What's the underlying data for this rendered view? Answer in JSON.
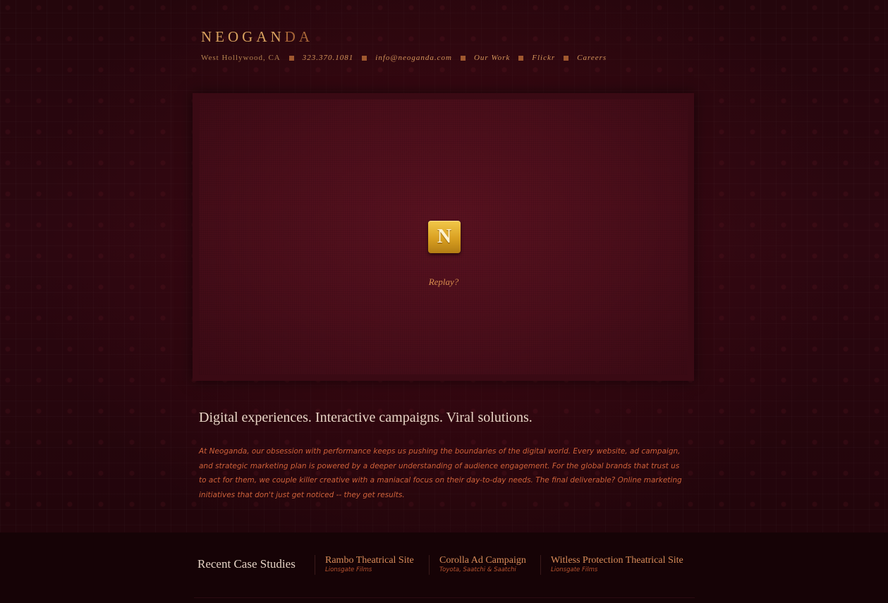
{
  "header": {
    "logo_part1": "NEOGAN",
    "logo_part2": "DA",
    "location": "West Hollywood, CA",
    "phone": "323.370.1081",
    "email": "info@neoganda.com",
    "nav": [
      "Our Work",
      "Flickr",
      "Careers"
    ]
  },
  "stage": {
    "logo_letter": "N",
    "replay_label": "Replay?"
  },
  "main": {
    "tagline": "Digital experiences. Interactive campaigns. Viral solutions.",
    "intro": "At Neoganda, our obsession with performance keeps us pushing the boundaries of the digital world. Every website, ad campaign, and strategic marketing plan is powered by a deeper understanding of audience engagement. For the global brands that trust us to act for them, we couple killer creative with a maniacal focus on their day-to-day needs. The final deliverable? Online marketing initiatives that don't just get noticed -- they get results."
  },
  "footer": {
    "title": "Recent Case Studies",
    "cases": [
      {
        "title": "Rambo Theatrical Site",
        "client": "Lionsgate Films"
      },
      {
        "title": "Corolla Ad Campaign",
        "client": "Toyota, Saatchi & Saatchi"
      },
      {
        "title": "Witless Protection Theatrical Site",
        "client": "Lionsgate Films"
      }
    ]
  },
  "colors": {
    "background": "#24060c",
    "accent_gold": "#d9a25f",
    "accent_orange": "#d0623a",
    "logo_badge": "#d9a021"
  }
}
